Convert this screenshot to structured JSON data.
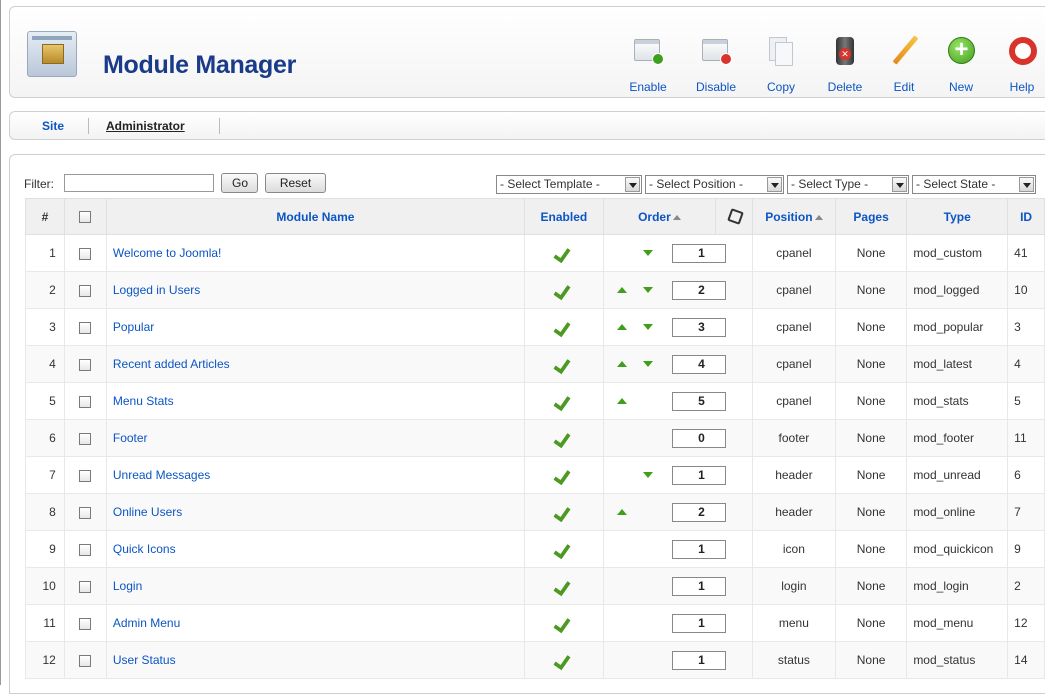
{
  "header": {
    "title": "Module Manager",
    "toolbar": [
      {
        "label": "Enable",
        "icon": "enable-icon"
      },
      {
        "label": "Disable",
        "icon": "disable-icon"
      },
      {
        "label": "Copy",
        "icon": "copy-icon"
      },
      {
        "label": "Delete",
        "icon": "delete-icon"
      },
      {
        "label": "Edit",
        "icon": "edit-icon"
      },
      {
        "label": "New",
        "icon": "new-icon"
      },
      {
        "label": "Help",
        "icon": "help-icon"
      }
    ]
  },
  "submenu": {
    "items": [
      "Site",
      "Administrator"
    ],
    "active": "Administrator"
  },
  "filter": {
    "label": "Filter:",
    "value": "",
    "go_label": "Go",
    "reset_label": "Reset",
    "selects": [
      "- Select Template -",
      "- Select Position -",
      "- Select Type -",
      "- Select State -"
    ]
  },
  "table": {
    "columns": {
      "num": "#",
      "name": "Module Name",
      "enabled": "Enabled",
      "order": "Order",
      "position": "Position",
      "pages": "Pages",
      "type": "Type",
      "id": "ID"
    },
    "rows": [
      {
        "num": "1",
        "name": "Welcome to Joomla!",
        "order": "1",
        "up": false,
        "down": true,
        "position": "cpanel",
        "pages": "None",
        "type": "mod_custom",
        "id": "41"
      },
      {
        "num": "2",
        "name": "Logged in Users",
        "order": "2",
        "up": true,
        "down": true,
        "position": "cpanel",
        "pages": "None",
        "type": "mod_logged",
        "id": "10"
      },
      {
        "num": "3",
        "name": "Popular",
        "order": "3",
        "up": true,
        "down": true,
        "position": "cpanel",
        "pages": "None",
        "type": "mod_popular",
        "id": "3"
      },
      {
        "num": "4",
        "name": "Recent added Articles",
        "order": "4",
        "up": true,
        "down": true,
        "position": "cpanel",
        "pages": "None",
        "type": "mod_latest",
        "id": "4"
      },
      {
        "num": "5",
        "name": "Menu Stats",
        "order": "5",
        "up": true,
        "down": false,
        "position": "cpanel",
        "pages": "None",
        "type": "mod_stats",
        "id": "5"
      },
      {
        "num": "6",
        "name": "Footer",
        "order": "0",
        "up": false,
        "down": false,
        "position": "footer",
        "pages": "None",
        "type": "mod_footer",
        "id": "11"
      },
      {
        "num": "7",
        "name": "Unread Messages",
        "order": "1",
        "up": false,
        "down": true,
        "position": "header",
        "pages": "None",
        "type": "mod_unread",
        "id": "6"
      },
      {
        "num": "8",
        "name": "Online Users",
        "order": "2",
        "up": true,
        "down": false,
        "position": "header",
        "pages": "None",
        "type": "mod_online",
        "id": "7"
      },
      {
        "num": "9",
        "name": "Quick Icons",
        "order": "1",
        "up": false,
        "down": false,
        "position": "icon",
        "pages": "None",
        "type": "mod_quickicon",
        "id": "9"
      },
      {
        "num": "10",
        "name": "Login",
        "order": "1",
        "up": false,
        "down": false,
        "position": "login",
        "pages": "None",
        "type": "mod_login",
        "id": "2"
      },
      {
        "num": "11",
        "name": "Admin Menu",
        "order": "1",
        "up": false,
        "down": false,
        "position": "menu",
        "pages": "None",
        "type": "mod_menu",
        "id": "12"
      },
      {
        "num": "12",
        "name": "User Status",
        "order": "1",
        "up": false,
        "down": false,
        "position": "status",
        "pages": "None",
        "type": "mod_status",
        "id": "14"
      }
    ]
  },
  "colors": {
    "link": "#0b55c4",
    "title": "#1a3a8a",
    "check": "#4d9a23"
  }
}
